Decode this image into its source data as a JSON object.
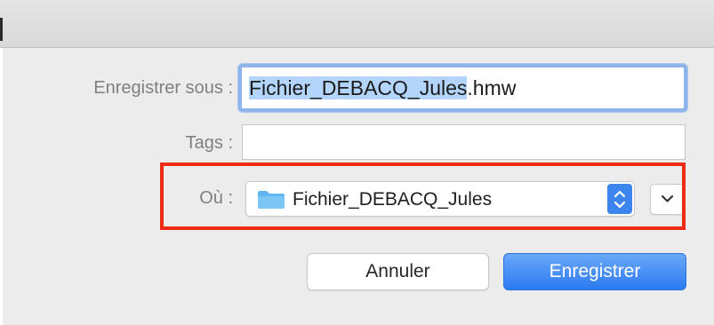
{
  "form": {
    "save_as_label": "Enregistrer sous :",
    "filename_selected": "Fichier_DEBACQ_Jules",
    "filename_extension": ".hmw",
    "tags_label": "Tags :",
    "tags_value": "",
    "where_label": "Où :",
    "where_value": "Fichier_DEBACQ_Jules"
  },
  "buttons": {
    "cancel_label": "Annuler",
    "save_label": "Enregistrer"
  },
  "colors": {
    "accent": "#2b7bf1",
    "annotation_outline": "#ef2b16",
    "selection": "#b3d4fb",
    "folder": "#62b5f0"
  },
  "icons": {
    "folder": "folder-icon",
    "stepper": "up-down-chevron-icon",
    "expand": "chevron-down-icon"
  }
}
